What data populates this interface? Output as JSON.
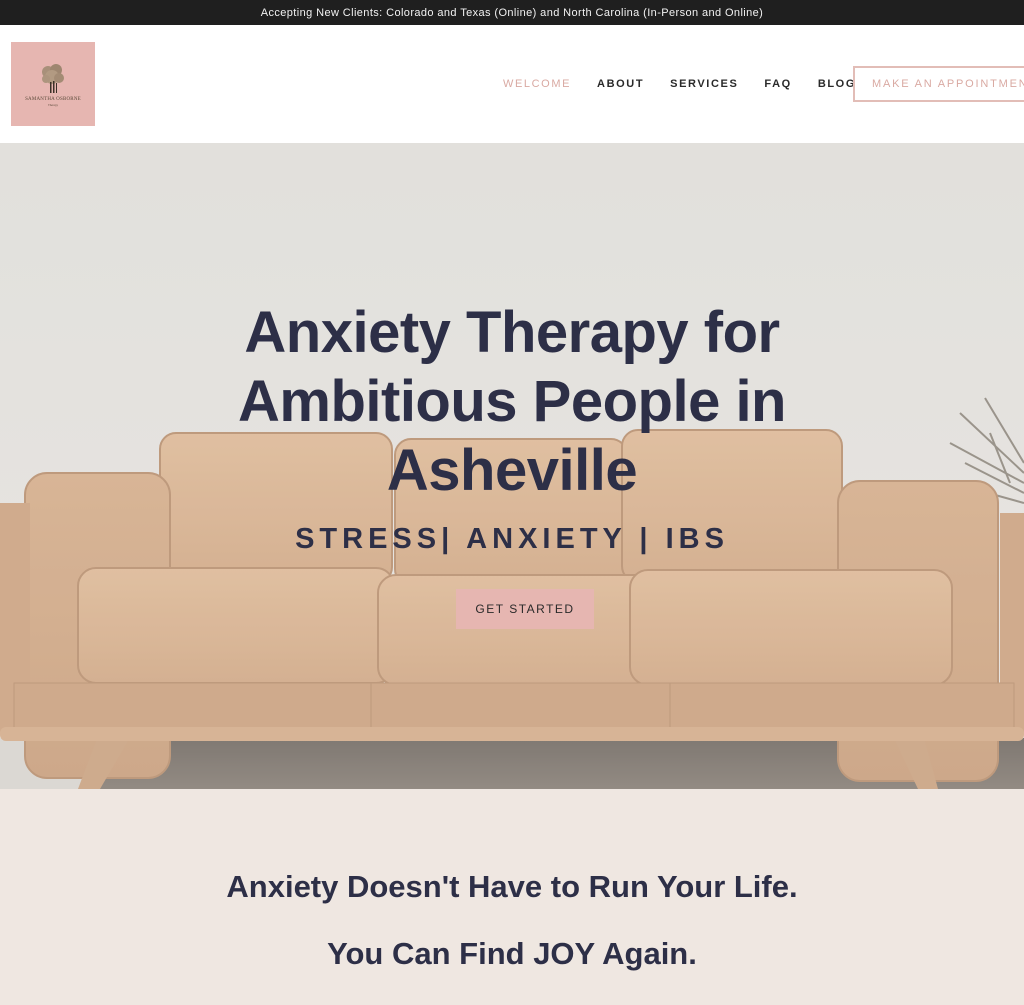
{
  "announcement": {
    "text": "Accepting New Clients: Colorado and Texas (Online) and North Carolina (In-Person and Online)"
  },
  "header": {
    "logo": {
      "name": "SAMANTHA OSBORNE",
      "subtitle": "Therapy",
      "icon": "tree-icon",
      "background_color": "#e6b6b1"
    },
    "nav": {
      "items": [
        {
          "label": "WELCOME",
          "active": true
        },
        {
          "label": "ABOUT",
          "active": false
        },
        {
          "label": "SERVICES",
          "active": false
        },
        {
          "label": "FAQ",
          "active": false
        },
        {
          "label": "BLOG",
          "active": false
        }
      ],
      "cta_label": "MAKE AN APPOINTMENT"
    }
  },
  "hero": {
    "title_lines": [
      "Anxiety Therapy for",
      "Ambitious People in",
      "Asheville"
    ],
    "subtitle": "STRESS| ANXIETY | IBS",
    "cta_label": "GET STARTED",
    "background_image": "leather-sofa-photo"
  },
  "intro": {
    "line1": "Anxiety Doesn't Have to Run Your Life.",
    "line2": "You Can Find JOY Again."
  },
  "colors": {
    "accent_pink": "#e6b6b1",
    "accent_text_pink": "#d9a9a2",
    "navy_text": "#2d2f47",
    "announcement_bg": "#1f1f1f",
    "section_bg": "#efe7e1"
  }
}
